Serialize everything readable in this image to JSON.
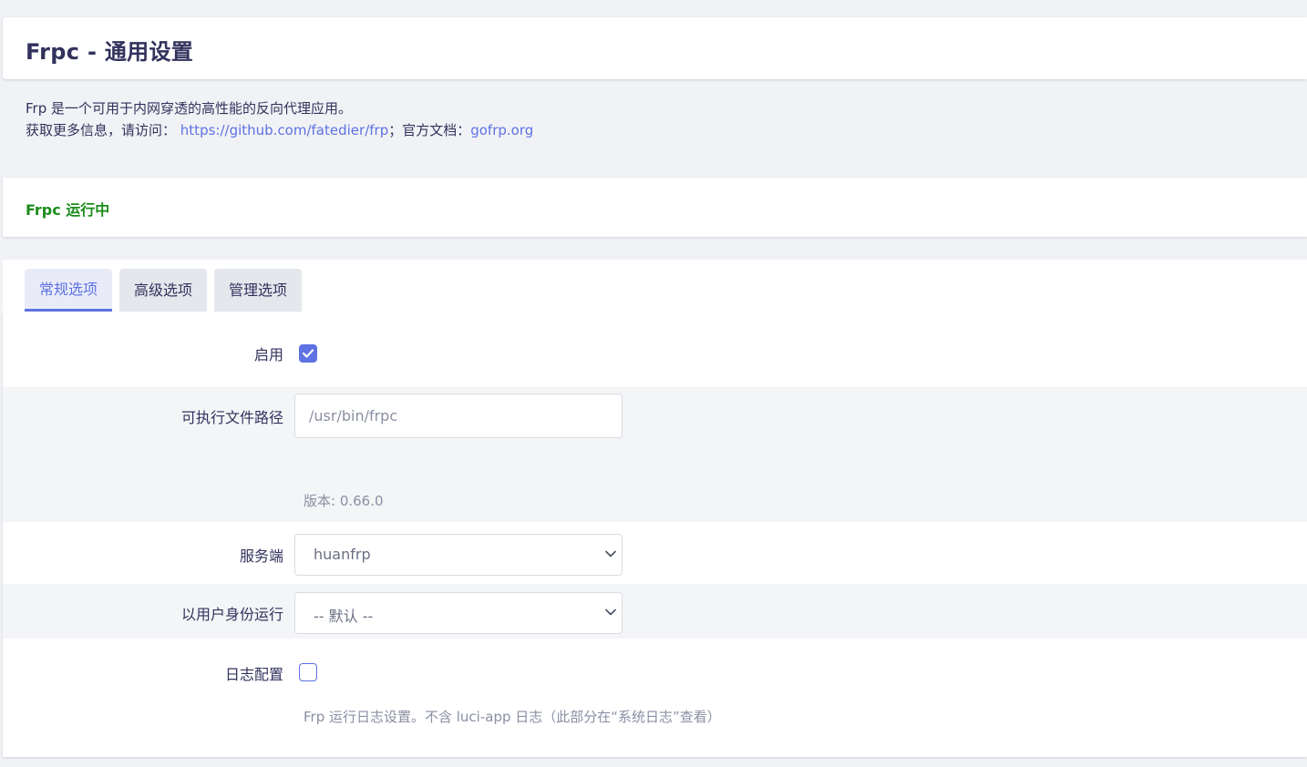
{
  "header": {
    "title": "Frpc - 通用设置"
  },
  "description": {
    "line1": "Frp 是一个可用于内网穿透的高性能的反向代理应用。",
    "line2_prefix": "获取更多信息，请访问：",
    "github_link": "https://github.com/fatedier/frp",
    "separator": "；官方文档：",
    "docs_link": "gofrp.org"
  },
  "status": {
    "text": "Frpc 运行中",
    "color": "#1b8c1b"
  },
  "tabs": [
    {
      "label": "常规选项",
      "active": true
    },
    {
      "label": "高级选项",
      "active": false
    },
    {
      "label": "管理选项",
      "active": false
    }
  ],
  "form": {
    "enable": {
      "label": "启用",
      "checked": true
    },
    "exec_path": {
      "label": "可执行文件路径",
      "placeholder": "/usr/bin/frpc",
      "value": "",
      "hint": "版本: 0.66.0"
    },
    "server": {
      "label": "服务端",
      "value": "huanfrp"
    },
    "run_as_user": {
      "label": "以用户身份运行",
      "value": "-- 默认 --"
    },
    "log_config": {
      "label": "日志配置",
      "checked": false,
      "hint": "Frp 运行日志设置。不含 luci-app 日志（此部分在“系统日志”查看）"
    }
  },
  "colors": {
    "accent": "#5e72e4",
    "text": "#32325d",
    "hint": "#8a8fa3",
    "background": "#f1f2f5"
  }
}
